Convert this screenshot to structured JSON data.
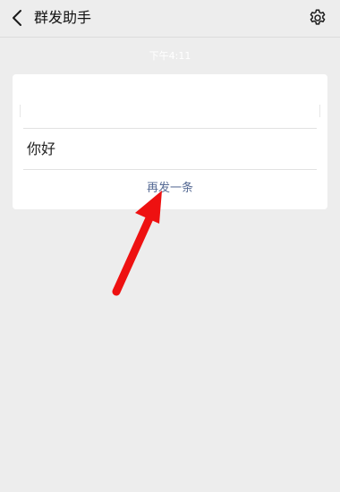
{
  "header": {
    "back_icon": "chevron-left-icon",
    "title": "群发助手",
    "settings_icon": "gear-icon"
  },
  "timestamp": "下午4:11",
  "card": {
    "message": "你好",
    "resend_label": "再发一条"
  },
  "annotation": {
    "arrow_color": "#ee1111"
  }
}
